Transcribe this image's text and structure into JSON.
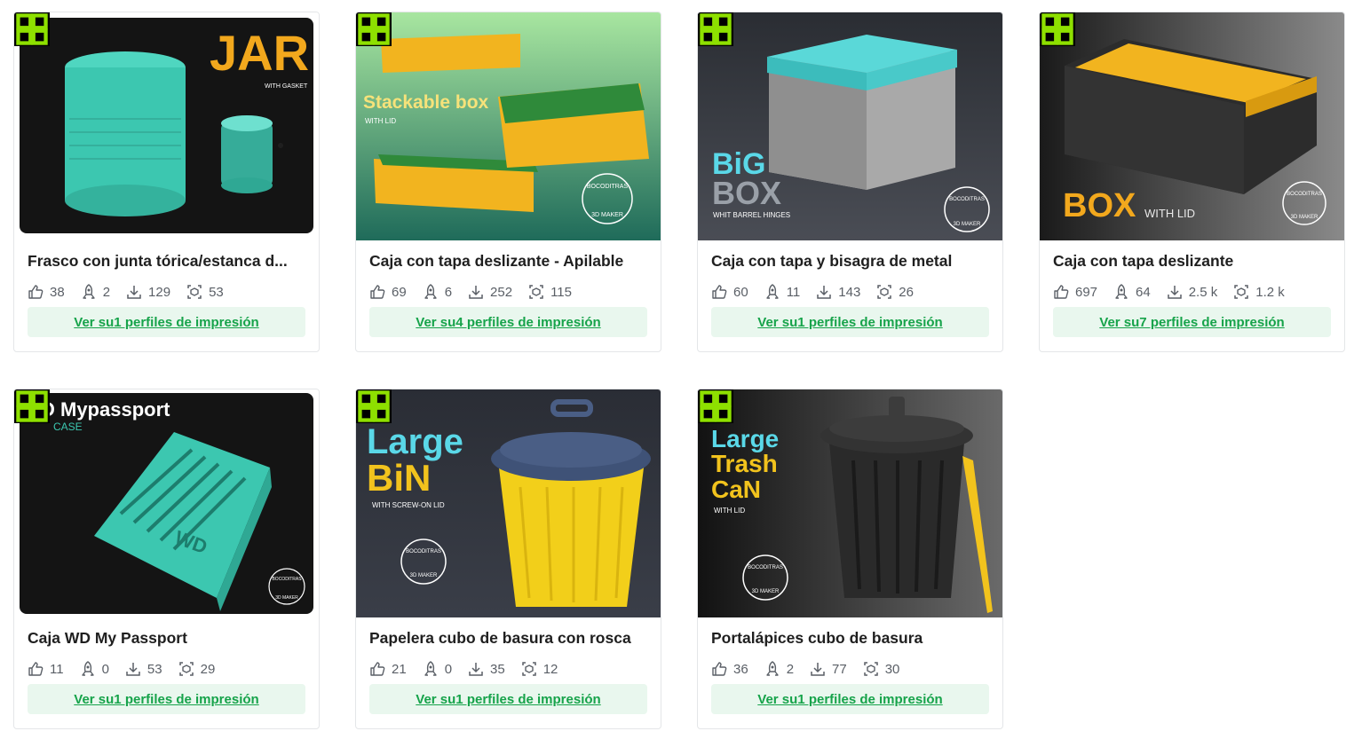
{
  "cards": [
    {
      "title": "Frasco con junta tórica/estanca d...",
      "likes": "38",
      "boosts": "2",
      "downloads": "129",
      "prints": "53",
      "cta": "Ver su1 perfiles de impresión",
      "img": {
        "line1": "JAR",
        "line2": "WITH GASKET"
      }
    },
    {
      "title": "Caja con tapa deslizante - Apilable",
      "likes": "69",
      "boosts": "6",
      "downloads": "252",
      "prints": "115",
      "cta": "Ver su4 perfiles de impresión",
      "img": {
        "line1": "Stackable box",
        "line2": "WITH LID",
        "maker1": "BOCODITRAS",
        "maker2": "3D MAKER"
      }
    },
    {
      "title": "Caja con tapa y bisagra de metal",
      "likes": "60",
      "boosts": "11",
      "downloads": "143",
      "prints": "26",
      "cta": "Ver su1 perfiles de impresión",
      "img": {
        "line1": "BiG",
        "line2": "BOX",
        "line3": "WHIT BARREL HINGES",
        "maker1": "BOCODITRAS",
        "maker2": "3D MAKER"
      }
    },
    {
      "title": "Caja con tapa deslizante",
      "likes": "697",
      "boosts": "64",
      "downloads": "2.5 k",
      "prints": "1.2 k",
      "cta": "Ver su7 perfiles de impresión",
      "img": {
        "line1": "BOX",
        "line2": "WITH LID",
        "maker1": "BOCODITRAS",
        "maker2": "3D MAKER"
      }
    },
    {
      "title": "Caja WD My Passport",
      "likes": "11",
      "boosts": "0",
      "downloads": "53",
      "prints": "29",
      "cta": "Ver su1 perfiles de impresión",
      "img": {
        "line1": "D Mypassport",
        "line2": "CASE",
        "logo": "WD",
        "maker1": "BOCODITRAS",
        "maker2": "3D MAKER"
      }
    },
    {
      "title": "Papelera cubo de basura con rosca",
      "likes": "21",
      "boosts": "0",
      "downloads": "35",
      "prints": "12",
      "cta": "Ver su1 perfiles de impresión",
      "img": {
        "line1": "Large",
        "line2": "BiN",
        "line3": "WITH SCREW-ON LID",
        "maker1": "BOCODITRAS",
        "maker2": "3D MAKER"
      }
    },
    {
      "title": "Portalápices cubo de basura",
      "likes": "36",
      "boosts": "2",
      "downloads": "77",
      "prints": "30",
      "cta": "Ver su1 perfiles de impresión",
      "img": {
        "line1": "Large",
        "line2": "Trash",
        "line3": "CaN",
        "line4": "WITH LID",
        "maker1": "BOCODITRAS",
        "maker2": "3D MAKER"
      }
    }
  ],
  "icons": {
    "likes": "thumbs-up-icon",
    "boosts": "rocket-icon",
    "downloads": "download-icon",
    "prints": "print-profile-icon",
    "badge": "cube-logo-icon"
  },
  "colors": {
    "accent": "#16a34a",
    "button_bg": "#e9f7ee",
    "badge": "#8ee000",
    "teal": "#3cc7b0",
    "yellow": "#f2b41f"
  }
}
